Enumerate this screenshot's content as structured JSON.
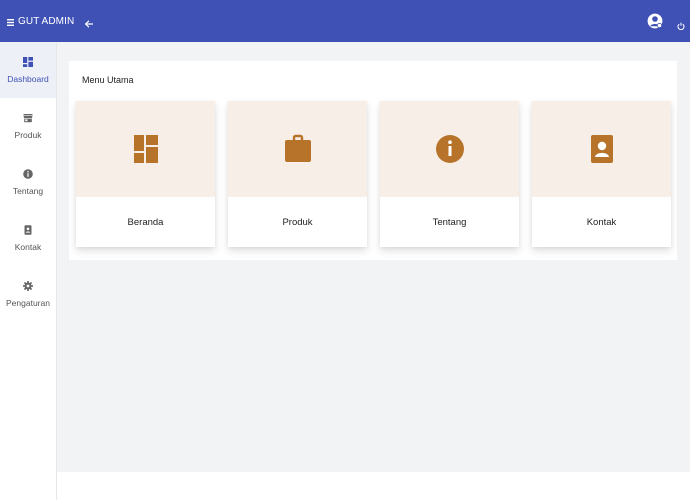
{
  "app": {
    "title": "GUT ADMIN",
    "accent_color": "#3f51b5",
    "card_icon_color": "#b8732a",
    "card_media_color": "#f7efe7"
  },
  "header": {
    "icons": [
      "menu-icon",
      "back-arrow-icon",
      "user-avatar-icon",
      "power-icon"
    ]
  },
  "sidebar": {
    "items": [
      {
        "label": "Dashboard",
        "icon": "dashboard-icon",
        "active": true
      },
      {
        "label": "Produk",
        "icon": "store-icon",
        "active": false
      },
      {
        "label": "Tentang",
        "icon": "info-icon",
        "active": false
      },
      {
        "label": "Kontak",
        "icon": "contact-book-icon",
        "active": false
      },
      {
        "label": "Pengaturan",
        "icon": "gear-icon",
        "active": false
      }
    ]
  },
  "main": {
    "title": "Menu Utama",
    "cards": [
      {
        "label": "Beranda",
        "icon": "dashboard-icon"
      },
      {
        "label": "Produk",
        "icon": "briefcase-icon"
      },
      {
        "label": "Tentang",
        "icon": "info-icon"
      },
      {
        "label": "Kontak",
        "icon": "contact-icon"
      }
    ]
  }
}
